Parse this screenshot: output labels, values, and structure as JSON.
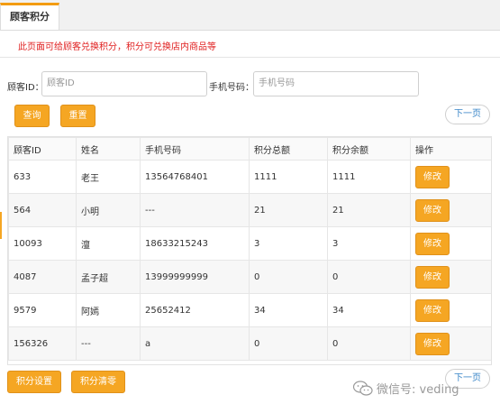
{
  "tab": {
    "label": "顾客积分"
  },
  "notice": "此页面可给顾客兑换积分，积分可兑换店内商品等",
  "search": {
    "id_label": "顾客ID：",
    "id_placeholder": "顾客ID",
    "phone_label": "手机号码：",
    "phone_placeholder": "手机号码",
    "query_label": "查询",
    "reset_label": "重置"
  },
  "pager": {
    "next_label": "下一页"
  },
  "table": {
    "headers": [
      "顾客ID",
      "姓名",
      "手机号码",
      "积分总额",
      "积分余额",
      "操作"
    ],
    "rows": [
      [
        "633",
        "老王",
        "13564768401",
        "1111",
        "1111"
      ],
      [
        "564",
        "小明",
        "---",
        "21",
        "21"
      ],
      [
        "10093",
        "澶",
        "18633215243",
        "3",
        "3"
      ],
      [
        "4087",
        "孟子超",
        "13999999999",
        "0",
        "0"
      ],
      [
        "9579",
        "阿嫣",
        "25652412",
        "34",
        "34"
      ],
      [
        "156326",
        "---",
        "a",
        "0",
        "0"
      ]
    ],
    "edit_label": "修改"
  },
  "footer": {
    "settings_label": "积分设置",
    "clear_label": "积分清零",
    "next_label": "下一页"
  },
  "watermark": {
    "icon": "wechat-icon",
    "text": "微信号: veding"
  }
}
